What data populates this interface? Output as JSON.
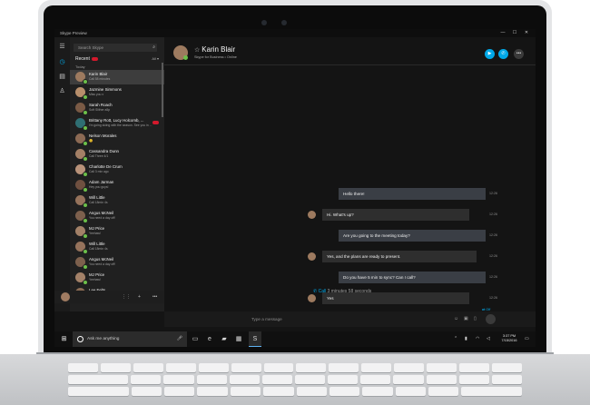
{
  "window": {
    "title": "Skype Preview",
    "controls": [
      "—",
      "☐",
      "✕"
    ]
  },
  "sidebar": {
    "search_placeholder": "Search Skype",
    "recent_label": "Recent",
    "recent_filter": "All ▾",
    "section_today": "Today",
    "contacts": [
      {
        "name": "Karin Blair",
        "status": "Call 58 minutes",
        "selected": true,
        "badge": false
      },
      {
        "name": "Jazmine Simmons",
        "status": "Miss you x",
        "selected": false,
        "badge": false
      },
      {
        "name": "Sarah Roach",
        "status": "Soft Slither a5p",
        "selected": false,
        "badge": false
      },
      {
        "name": "Brittany Rott, Lucy Holcomb, ...",
        "status": "I'm going skiing with the season. See you in ...",
        "selected": false,
        "badge": true
      },
      {
        "name": "Nelson Morales",
        "status": "😊",
        "selected": false,
        "badge": false
      },
      {
        "name": "Cassandra Dunn",
        "status": "Call Three 4/1",
        "selected": false,
        "badge": false
      },
      {
        "name": "Charlotte De Crum",
        "status": "Call 3 min ago",
        "selected": false,
        "badge": false
      },
      {
        "name": "Adam Jarman",
        "status": "Hey you guys!",
        "selected": false,
        "badge": false
      },
      {
        "name": "Will Little",
        "status": "Call 18min 4s",
        "selected": false,
        "badge": false
      },
      {
        "name": "Angus McNeil",
        "status": "You need a day off!",
        "selected": false,
        "badge": false
      },
      {
        "name": "MJ Price",
        "status": "Yeehaw!",
        "selected": false,
        "badge": false
      },
      {
        "name": "Will Little",
        "status": "Call 18min 4s",
        "selected": false,
        "badge": false
      },
      {
        "name": "Angus McNeil",
        "status": "You need a day off!",
        "selected": false,
        "badge": false
      },
      {
        "name": "MJ Price",
        "status": "Yeehaw!",
        "selected": false,
        "badge": false
      },
      {
        "name": "Lee Felts",
        "status": "Call 15min 33s",
        "selected": false,
        "badge": false
      }
    ]
  },
  "conversation": {
    "contact_name": "Karin Blair",
    "contact_status": "Skype for Business • Online",
    "messages": [
      {
        "text": "Hello there!",
        "dir": "out",
        "time": "12:26"
      },
      {
        "text": "Hi. What's up?",
        "dir": "in",
        "time": "12:26"
      },
      {
        "text": "Are you going to the meeting today?",
        "dir": "out",
        "time": "12:26"
      },
      {
        "text": "Yes, and the plans are ready to present.",
        "dir": "in",
        "time": "12:26"
      },
      {
        "text": "Do you have 5 min to sync? Can I call?",
        "dir": "out",
        "time": "12:26"
      },
      {
        "text": "Yes",
        "dir": "in",
        "time": "12:26"
      }
    ],
    "call_summary": "Call",
    "call_duration": "3 minutes 58 seconds",
    "off_label": "Off",
    "compose_placeholder": "Type a message"
  },
  "taskbar": {
    "search_placeholder": "Ask me anything",
    "time": "3:37 PM",
    "date": "7/15/2016"
  },
  "colors": {
    "accent": "#00a8e8",
    "presence": "#6cc04a",
    "badge": "#d4192c",
    "screen_bg": "#141414"
  },
  "icons": {
    "rail": [
      "hamburger-icon",
      "recent-icon",
      "contacts-icon",
      "people-icon",
      "settings-icon"
    ],
    "header": [
      "video-call-icon",
      "audio-call-icon",
      "more-icon"
    ],
    "taskbar": [
      "windows-start-icon",
      "cortana-icon",
      "microphone-icon",
      "task-view-icon",
      "edge-icon",
      "file-explorer-icon",
      "store-icon",
      "skype-icon",
      "notification-icon"
    ]
  }
}
